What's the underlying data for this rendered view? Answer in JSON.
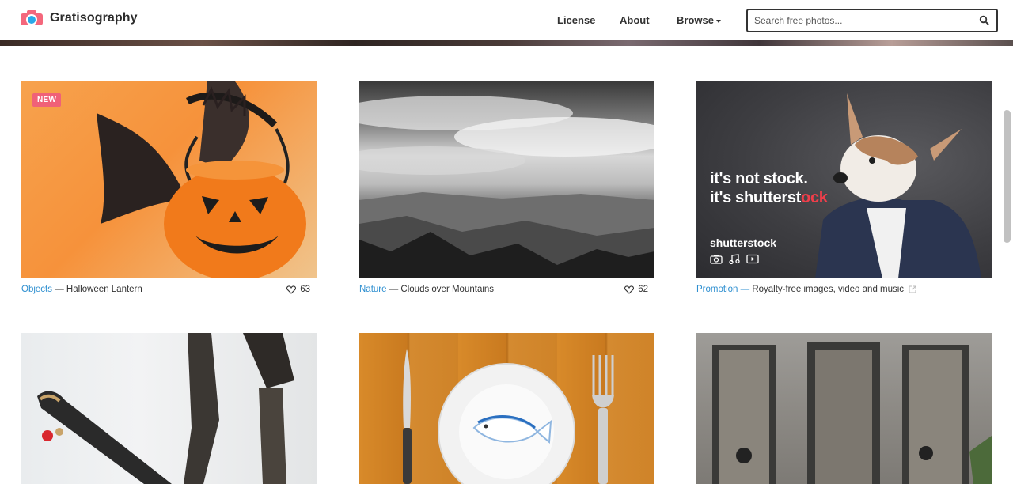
{
  "header": {
    "brand": "Gratisography",
    "nav": [
      {
        "label": "License"
      },
      {
        "label": "About"
      },
      {
        "label": "Browse"
      }
    ],
    "search": {
      "placeholder": "Search free photos..."
    }
  },
  "cards": [
    {
      "badge": "NEW",
      "category": "Objects",
      "separator": " — ",
      "title": "Halloween Lantern",
      "likes": "63"
    },
    {
      "category": "Nature",
      "separator": " — ",
      "title": "Clouds over Mountains",
      "likes": "62"
    },
    {
      "category": "Promotion",
      "separator": " — ",
      "title": "Royalty-free images, video and music",
      "promo_line1": "it's not stock.",
      "promo_line2_a": "it's shutterst",
      "promo_line2_b": "o",
      "promo_line2_c": "ck",
      "promo_brand": "shutterstock"
    },
    {
      "category": "",
      "title": ""
    },
    {
      "category": "",
      "title": ""
    },
    {
      "category": "",
      "title": ""
    }
  ],
  "colors": {
    "accent": "#2e8fd0",
    "badge": "#f06178",
    "logo_pink": "#f4677c",
    "logo_blue": "#2aa8e8"
  },
  "icons": [
    "camera-logo-icon",
    "search-icon",
    "heart-icon",
    "external-link-icon",
    "chevron-down-icon"
  ]
}
